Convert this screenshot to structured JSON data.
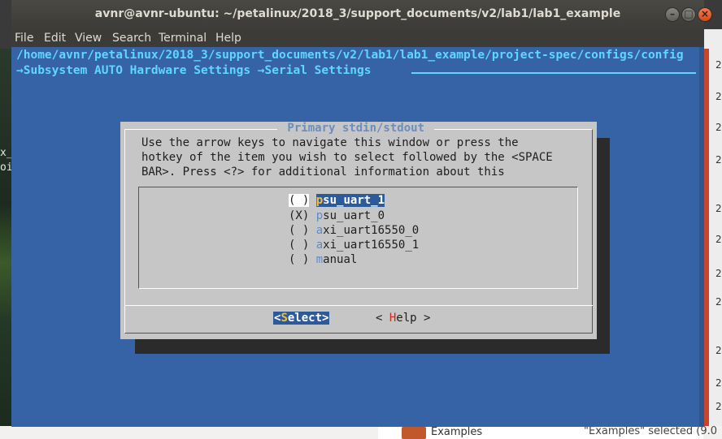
{
  "window": {
    "title": "avnr@avnr-ubuntu: ~/petalinux/2018_3/support_documents/v2/lab1/lab1_example",
    "btn_minimize": "–",
    "btn_maximize": "□",
    "btn_close": "×"
  },
  "menubar": {
    "file": "File",
    "edit": "Edit",
    "view": "View",
    "search": "Search",
    "terminal": "Terminal",
    "help": "Help"
  },
  "terminal": {
    "path": "/home/avnr/petalinux/2018_3/support_documents/v2/lab1/lab1_example/project-spec/configs/config",
    "breadcrumb": "→Subsystem AUTO Hardware Settings →Serial Settings"
  },
  "dialog": {
    "title": " Primary stdin/stdout ",
    "help_line_1": "Use the arrow keys to navigate this window or press the",
    "help_line_2": "hotkey of the item you wish to select followed by the <SPACE",
    "help_line_3": "BAR>. Press <?> for additional information about this",
    "options": [
      {
        "mark": "( )",
        "hotkey": "p",
        "rest": "su_uart_1"
      },
      {
        "mark": "(X)",
        "hotkey": "p",
        "rest": "su_uart_0"
      },
      {
        "mark": "( )",
        "hotkey": "a",
        "rest": "xi_uart16550_0"
      },
      {
        "mark": "( )",
        "hotkey": "a",
        "rest": "xi_uart16550_1"
      },
      {
        "mark": "( )",
        "hotkey": "m",
        "rest": "anual"
      }
    ],
    "select_open": "<",
    "select_hotkey": "S",
    "select_rest": "elect>",
    "help_open": "< ",
    "help_hotkey": "H",
    "help_rest": "elp >"
  },
  "background": {
    "left_text_1": "x_",
    "left_text_2": "oi",
    "right_digits": [
      "2",
      "2",
      "2",
      "2",
      "2",
      "2",
      "2",
      "2",
      "2",
      "2",
      "2"
    ],
    "bottom_label": "Examples",
    "bottom_status": "\"Examples\" selected (9.0"
  }
}
